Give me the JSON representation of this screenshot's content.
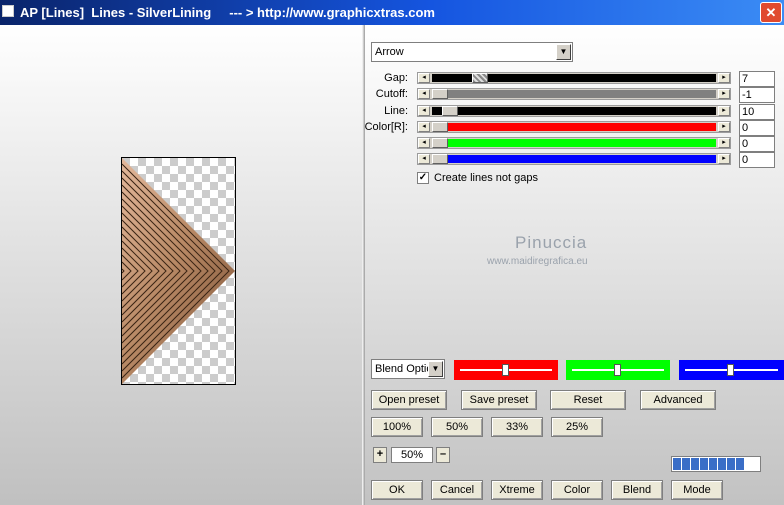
{
  "window": {
    "title": "AP [Lines]  Lines - SilverLining     --- > http://www.graphicxtras.com",
    "close_symbol": "✕"
  },
  "controls": {
    "mode_select": {
      "value": "Arrow"
    },
    "gap": {
      "label": "Gap:",
      "value": "7"
    },
    "cutoff": {
      "label": "Cutoff:",
      "value": "-1"
    },
    "line": {
      "label": "Line:",
      "value": "10"
    },
    "color_r": {
      "label": "Color[R]:",
      "value": "0"
    },
    "color_g": {
      "value": "0"
    },
    "color_b": {
      "value": "0"
    },
    "checkbox": {
      "label": "Create lines not gaps",
      "checked_mark": "✓",
      "checked": true
    }
  },
  "watermark": {
    "name": "Pinuccia",
    "site": "www.maidiregrafica.eu"
  },
  "blend": {
    "select_value": "Blend Optio",
    "colors": [
      "#ff0000",
      "#00ff00",
      "#0000ff"
    ]
  },
  "buttons": {
    "open_preset": "Open preset",
    "save_preset": "Save preset",
    "reset": "Reset",
    "advanced": "Advanced",
    "zoom_100": "100%",
    "zoom_50": "50%",
    "zoom_33": "33%",
    "zoom_25": "25%",
    "ok": "OK",
    "cancel": "Cancel",
    "xtreme": "Xtreme",
    "color": "Color",
    "blend": "Blend",
    "mode": "Mode"
  },
  "zoom": {
    "plus": "+",
    "minus": "–",
    "value": "50%"
  },
  "arrows": {
    "left": "◂",
    "right": "▸",
    "down": "▼"
  },
  "progress": {
    "segments": 8
  }
}
